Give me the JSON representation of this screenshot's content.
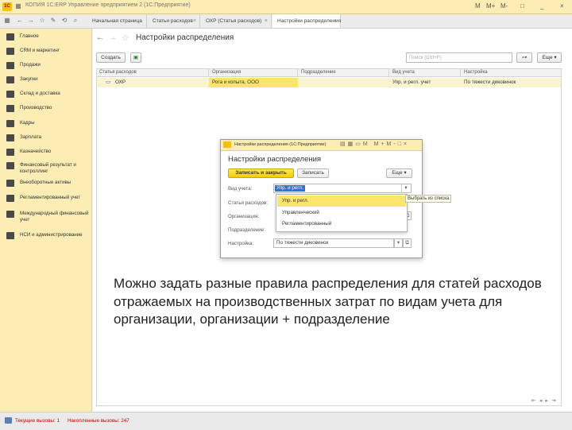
{
  "app": {
    "title": "КОПИЯ 1С:ERP Управление предприятием 2 (1С:Предприятие)",
    "logo": "1C",
    "header_icons": [
      "grid-icon",
      "back-icon",
      "forward-icon"
    ],
    "right_controls": [
      "М",
      "М+",
      "М-",
      "□",
      "_",
      "×"
    ]
  },
  "tabs": [
    {
      "label": "Начальная страница",
      "active": false
    },
    {
      "label": "Статьи расходов",
      "active": false
    },
    {
      "label": "ОХР (Статья расходов)",
      "active": false
    },
    {
      "label": "Настройки распределения",
      "active": true
    }
  ],
  "sidebar": {
    "items": [
      {
        "label": "Главное",
        "icon": "menu-icon"
      },
      {
        "label": "CRM и маркетинг",
        "icon": "crm-icon"
      },
      {
        "label": "Продажи",
        "icon": "sales-icon"
      },
      {
        "label": "Закупки",
        "icon": "cart-icon"
      },
      {
        "label": "Склад и доставка",
        "icon": "warehouse-icon"
      },
      {
        "label": "Производство",
        "icon": "factory-icon"
      },
      {
        "label": "Кадры",
        "icon": "people-icon"
      },
      {
        "label": "Зарплата",
        "icon": "salary-icon"
      },
      {
        "label": "Казначейство",
        "icon": "treasury-icon"
      },
      {
        "label": "Финансовый результат и контроллинг",
        "icon": "finance-icon"
      },
      {
        "label": "Внеоборотные активы",
        "icon": "assets-icon"
      },
      {
        "label": "Регламентированный учет",
        "icon": "regulated-icon"
      },
      {
        "label": "Международный финансовый учет",
        "icon": "intl-icon"
      },
      {
        "label": "НСИ и администрирование",
        "icon": "admin-icon"
      }
    ]
  },
  "main": {
    "title": "Настройки распределения",
    "create_label": "Создать",
    "search_placeholder": "Поиск (Ctrl+F)",
    "more_label": "Еще",
    "columns": [
      "Статья расходов",
      "Организация",
      "Подразделение",
      "Вид учета",
      "Настройка"
    ],
    "rows": [
      {
        "expense": "ОХР",
        "org": "Рога и копыта, ООО",
        "dept": "",
        "account_type": "Упр. и регл. учет",
        "setting": "По тяжести диковинок"
      }
    ]
  },
  "modal": {
    "app_title": "Настройки распределения (1С:Предприятие)",
    "title": "Настройки распределения",
    "save_close_label": "Записать и закрыть",
    "save_label": "Записать",
    "more_label": "Еще",
    "fields": {
      "account_type_label": "Вид учета:",
      "account_type_value": "Упр. и регл.",
      "expense_label": "Статья расходов:",
      "org_label": "Организация:",
      "dept_label": "Подразделение:",
      "setting_label": "Настройка:",
      "setting_value": "По тяжести диковинок"
    },
    "tooltip": "Выбрать из списка",
    "dropdown": [
      "Упр. и регл.",
      "Управленческий",
      "Регламентированный"
    ],
    "dropdown_selected_index": 0
  },
  "caption": "Можно задать разные правила распределения для статей расходов отражаемых на производственных затрат по видам учета для организации, организации + подразделение",
  "status": {
    "current_calls": "Текущие вызовы: 1",
    "accumulated_calls": "Накопленные вызовы: 247"
  },
  "colors": {
    "accent_yellow": "#fbedb4",
    "button_yellow": "#f5cd00",
    "row_highlight": "#fce56d",
    "status_red": "#cc0000"
  }
}
